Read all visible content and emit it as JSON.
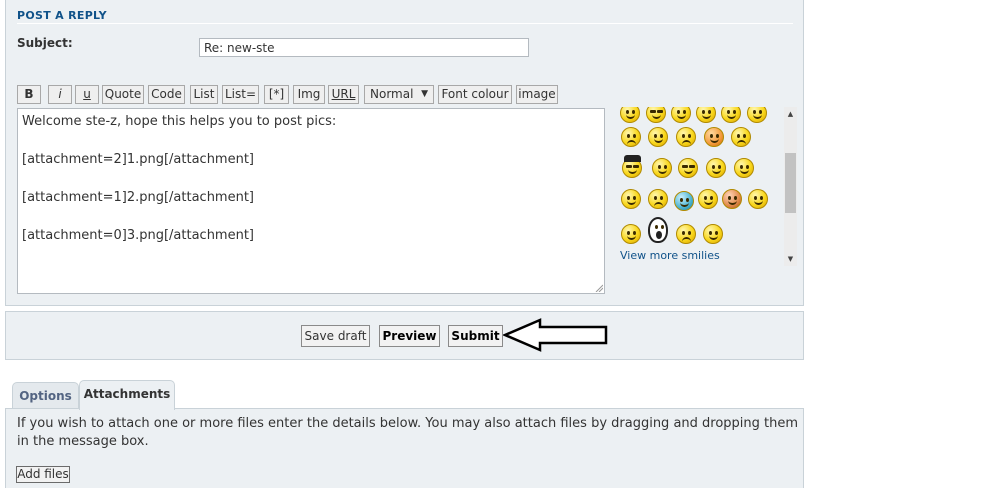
{
  "post_reply": {
    "section_title": "POST A REPLY",
    "subject_label": "Subject:",
    "subject_value": "Re: new-ste"
  },
  "toolbar": {
    "bold": "B",
    "italic": "i",
    "underline": "u",
    "quote": "Quote",
    "code": "Code",
    "list": "List",
    "list_ordered": "List=",
    "list_item": "[*]",
    "img": "Img",
    "url": "URL",
    "font_size_selected": "Normal",
    "font_colour": "Font colour",
    "image": "image"
  },
  "message": {
    "lines": [
      "Welcome ste-z, hope this helps you to post pics:",
      "",
      "[attachment=2]1.png[/attachment]",
      "",
      "[attachment=1]2.png[/attachment]",
      "",
      "[attachment=0]3.png[/attachment]"
    ]
  },
  "smilies": {
    "view_more": "View more smilies"
  },
  "submit_bar": {
    "save_draft": "Save draft",
    "preview": "Preview",
    "submit": "Submit"
  },
  "tabs": {
    "options": "Options",
    "attachments": "Attachments"
  },
  "attachments": {
    "instructions": "If you wish to attach one or more files enter the details below. You may also attach files by dragging and dropping them in the message box.",
    "add_files": "Add files"
  },
  "colors": {
    "panel_bg": "#ecf0f3",
    "title_blue": "#105289",
    "link_blue": "#105289"
  }
}
